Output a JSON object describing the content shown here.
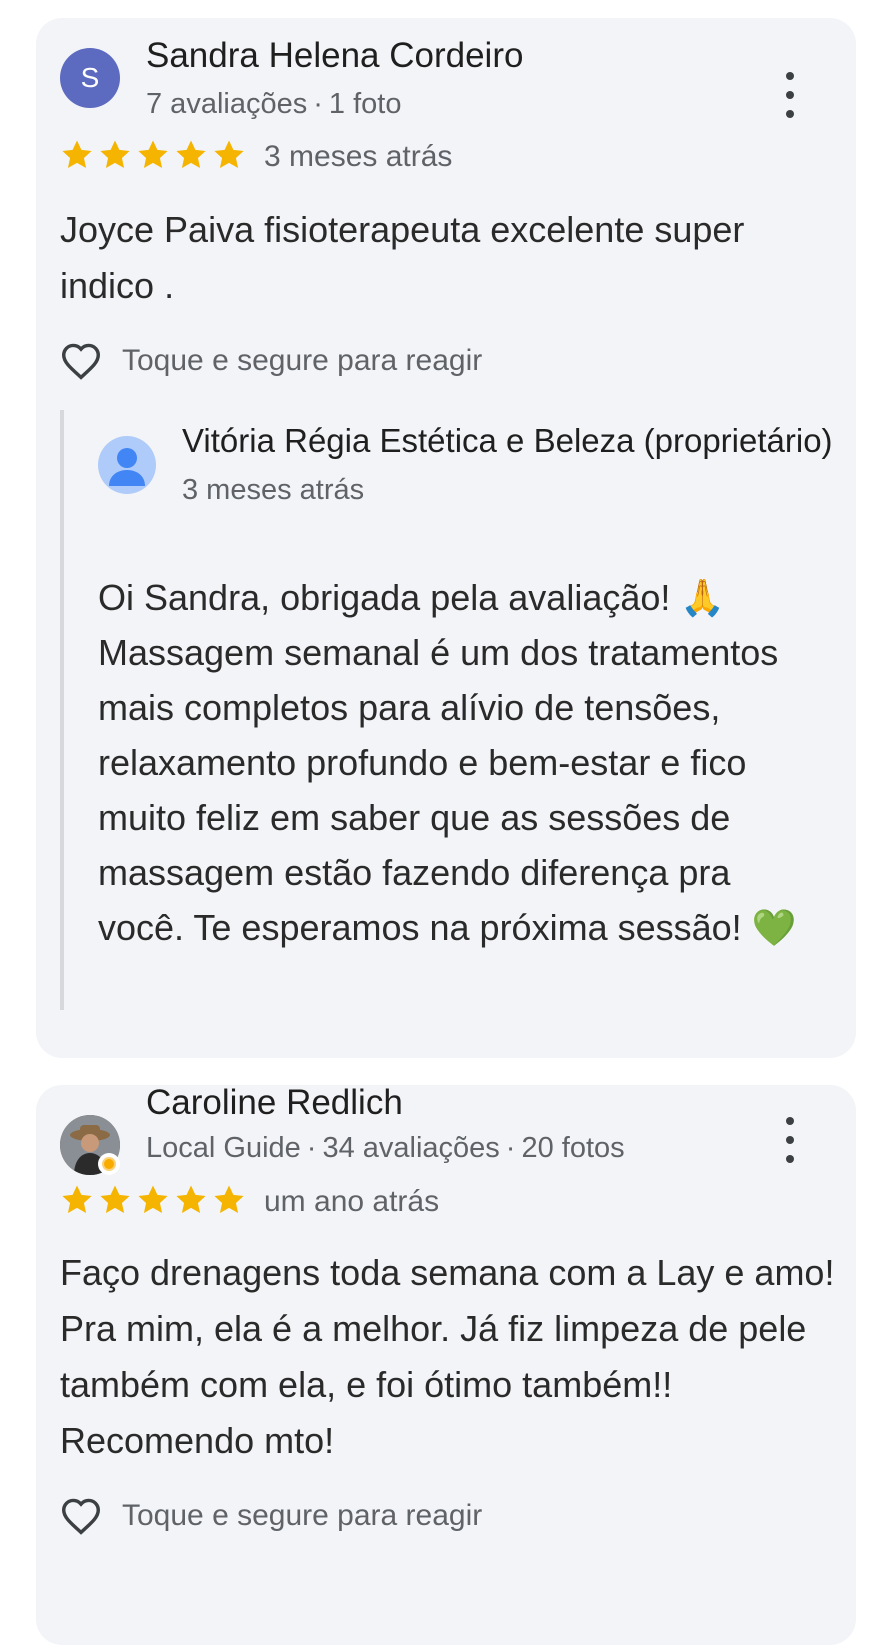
{
  "reviews": [
    {
      "author": "Sandra Helena Cordeiro",
      "avatar_initial": "S",
      "meta": [
        "7 avaliações",
        "1 foto"
      ],
      "rating": 5,
      "date": "3 meses atrás",
      "text": "Joyce Paiva fisioterapeuta excelente super indico .",
      "react_label": "Toque e segure para reagir",
      "reply": {
        "owner": "Vitória Régia Estética e Beleza (proprietário)",
        "date": "3 meses atrás",
        "text": "Oi Sandra, obrigada pela avaliação! 🙏 Massagem semanal é um dos tratamentos mais completos para alívio de tensões, relaxamento profundo e bem-estar e fico muito feliz em saber que as sessões de massagem estão fazendo diferença pra você. Te esperamos na próxima sessão! 💚"
      }
    },
    {
      "author": "Caroline Redlich",
      "meta": [
        "Local Guide",
        "34 avaliações",
        "20 fotos"
      ],
      "rating": 5,
      "date": "um ano atrás",
      "text": "Faço drenagens toda semana com a Lay e amo! Pra mim, ela é a melhor. Já fiz limpeza de pele também com ela, e foi ótimo também!! Recomendo mto!",
      "react_label": "Toque e segure para reagir"
    }
  ],
  "colors": {
    "star": "#f4b400",
    "card": "#f3f4f7",
    "avatar_s": "#5c6bc0",
    "owner_avatar": "#aecbfa"
  },
  "icons": [
    "star-icon",
    "heart-outline-icon",
    "more-vert-icon",
    "person-icon",
    "local-guide-badge-icon"
  ]
}
